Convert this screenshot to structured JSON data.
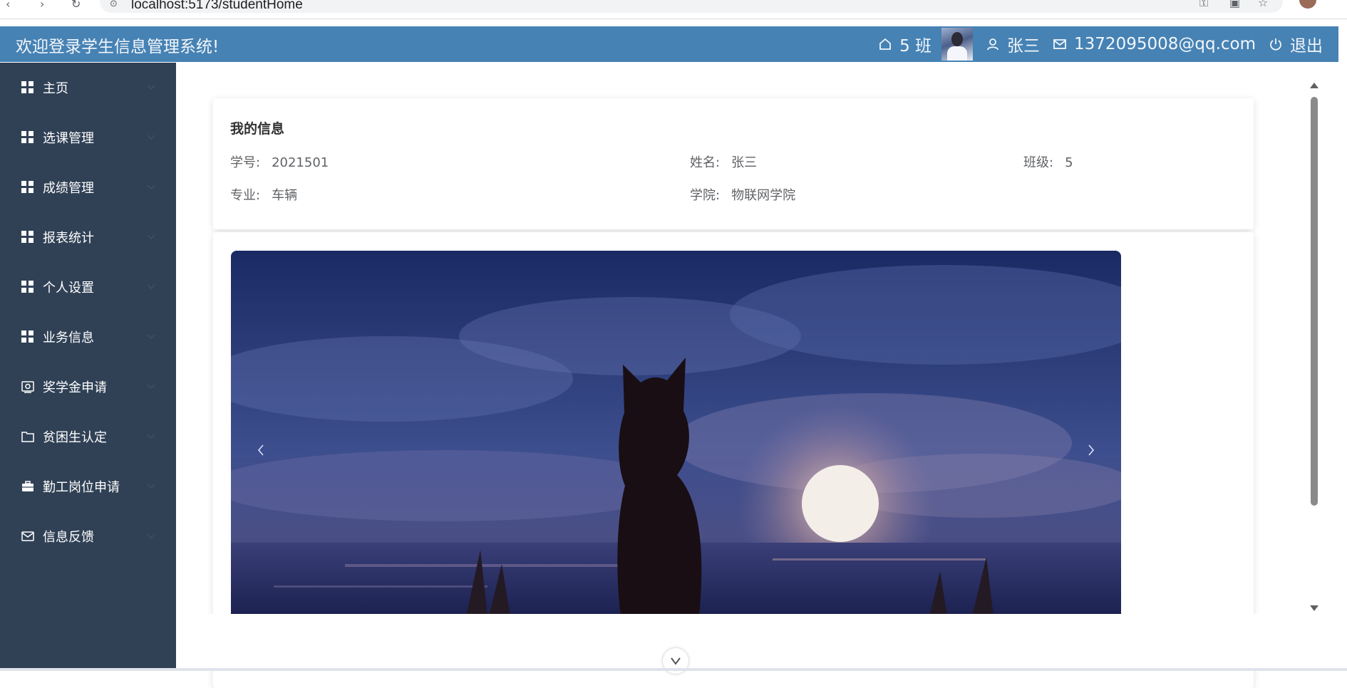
{
  "browser": {
    "url": "localhost:5173/studentHome"
  },
  "header": {
    "welcome": "欢迎登录学生信息管理系统!",
    "class_label": "5 班",
    "user_name": "张三",
    "email": "1372095008@qq.com",
    "logout_label": "退出"
  },
  "sidebar": {
    "items": [
      {
        "label": "主页",
        "icon": "grid-icon"
      },
      {
        "label": "选课管理",
        "icon": "grid-icon"
      },
      {
        "label": "成绩管理",
        "icon": "grid-icon"
      },
      {
        "label": "报表统计",
        "icon": "grid-icon"
      },
      {
        "label": "个人设置",
        "icon": "grid-icon"
      },
      {
        "label": "业务信息",
        "icon": "grid-icon"
      },
      {
        "label": "奖学金申请",
        "icon": "money-icon"
      },
      {
        "label": "贫困生认定",
        "icon": "folder-icon"
      },
      {
        "label": "勤工岗位申请",
        "icon": "briefcase-icon"
      },
      {
        "label": "信息反馈",
        "icon": "mail-icon"
      }
    ]
  },
  "info": {
    "title": "我的信息",
    "student_id_label": "学号:",
    "student_id": "2021501",
    "name_label": "姓名:",
    "name": "张三",
    "class_label": "班级:",
    "class_value": "5",
    "major_label": "专业:",
    "major": "车辆",
    "college_label": "学院:",
    "college": "物联网学院"
  },
  "carousel": {
    "prev_icon": "chevron-left-icon",
    "next_icon": "chevron-right-icon"
  },
  "colors": {
    "header_bg": "#4682b4",
    "sidebar_bg": "#304156"
  }
}
